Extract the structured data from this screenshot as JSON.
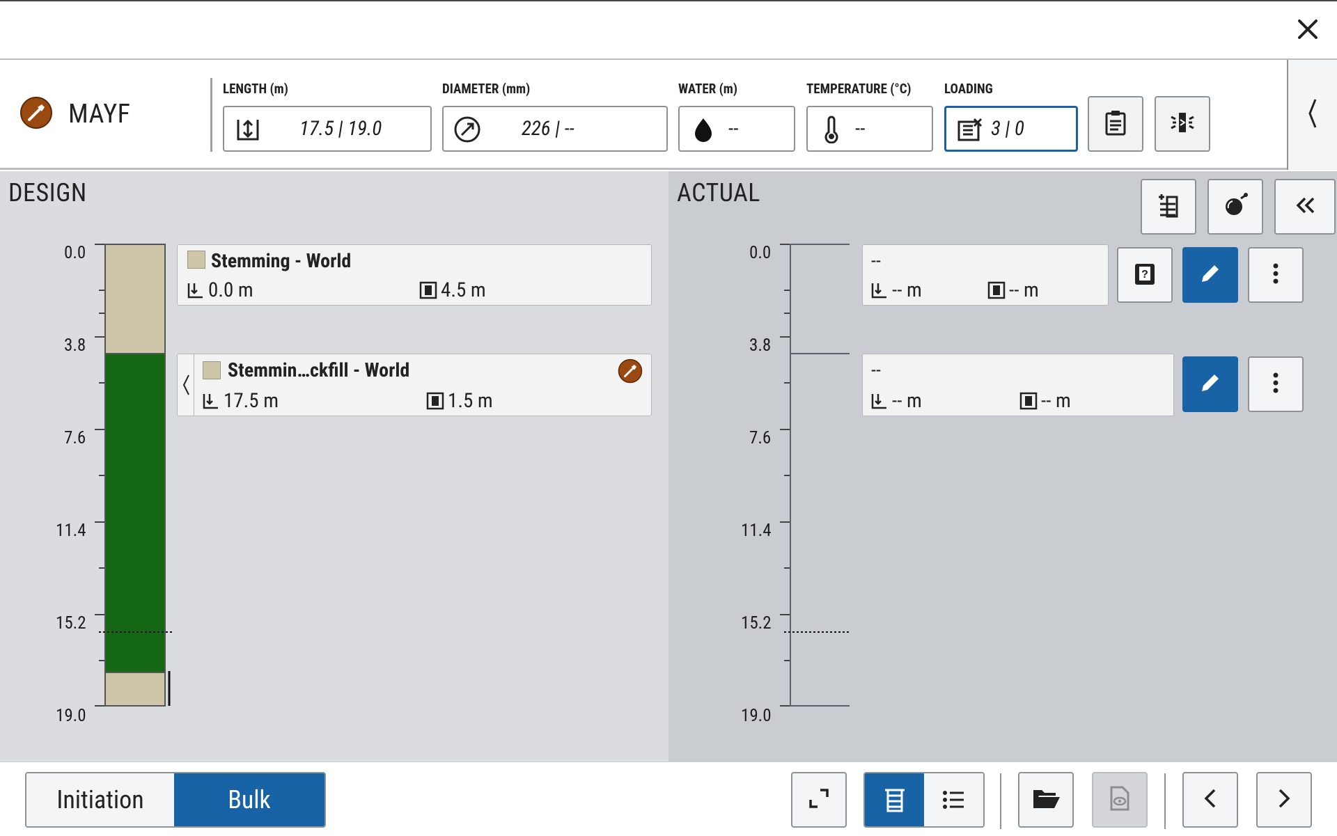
{
  "topbar": {
    "close_icon": "close-icon"
  },
  "header": {
    "hole_name": "MAYF",
    "length": {
      "caption": "LENGTH (m)",
      "value": "17.5 | 19.0"
    },
    "diameter": {
      "caption": "DIAMETER (mm)",
      "value": "226 | --"
    },
    "water": {
      "caption": "WATER (m)",
      "value": "--"
    },
    "temperature": {
      "caption": "TEMPERATURE (°C)",
      "value": "--"
    },
    "loading": {
      "caption": "LOADING",
      "value": "3 | 0"
    }
  },
  "design": {
    "title": "DESIGN",
    "axis_ticks": [
      "0.0",
      "3.8",
      "7.6",
      "11.4",
      "15.2",
      "19.0"
    ],
    "decks": [
      {
        "name": "Stemming - World",
        "top": "0.0 m",
        "length": "4.5 m"
      },
      {
        "name": "Stemmin…ckfill - World",
        "top": "17.5 m",
        "length": "1.5 m"
      }
    ],
    "colors": {
      "stemming": "#cec6a9",
      "explosive": "#146814"
    }
  },
  "actual": {
    "title": "ACTUAL",
    "axis_ticks": [
      "0.0",
      "3.8",
      "7.6",
      "11.4",
      "15.2",
      "19.0"
    ],
    "decks": [
      {
        "name": "--",
        "top": "-- m",
        "length": "-- m"
      },
      {
        "name": "--",
        "top": "-- m",
        "length": "-- m"
      }
    ]
  },
  "bottom": {
    "tabs": [
      {
        "label": "Initiation",
        "selected": false
      },
      {
        "label": "Bulk",
        "selected": true
      }
    ]
  },
  "colors": {
    "accent": "#1763a6",
    "design_bg": "#dadcdf",
    "actual_bg": "#c9ccd1",
    "brown_badge": "#9a4a10"
  }
}
